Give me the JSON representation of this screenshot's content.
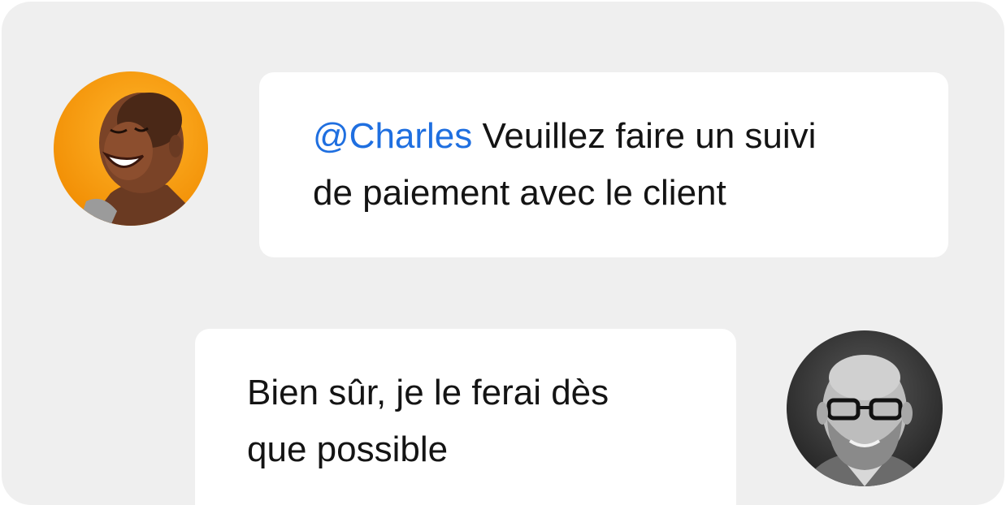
{
  "chat": {
    "messages": [
      {
        "mention": "@Charles",
        "text_line1": "Veuillez faire un suivi",
        "text_line2": "de paiement avec le client",
        "avatar_icon": "smiling-woman-avatar",
        "avatar_bg": "#f5a000"
      },
      {
        "text_line1": "Bien sûr, je le ferai dès",
        "text_line2": "que possible",
        "avatar_icon": "bearded-man-glasses-avatar"
      }
    ],
    "colors": {
      "panel_bg": "#efefef",
      "bubble_bg": "#ffffff",
      "mention": "#1f6fe0",
      "text": "#141414"
    }
  }
}
